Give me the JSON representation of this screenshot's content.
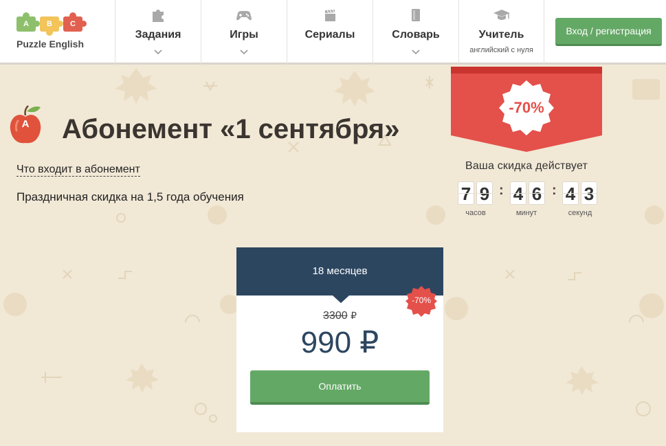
{
  "brand": {
    "name": "Puzzle English",
    "pieces": [
      "A",
      "B",
      "C"
    ],
    "colors": [
      "#8ec06c",
      "#f2c45a",
      "#e2604f"
    ]
  },
  "nav": {
    "items": [
      {
        "label": "Задания",
        "icon": "puzzle-icon",
        "dropdown": true
      },
      {
        "label": "Игры",
        "icon": "gamepad-icon",
        "dropdown": true
      },
      {
        "label": "Сериалы",
        "icon": "clapperboard-icon",
        "dropdown": false
      },
      {
        "label": "Словарь",
        "icon": "book-icon",
        "dropdown": true
      },
      {
        "label": "Учитель",
        "sub": "английский с нуля",
        "icon": "graduation-cap-icon",
        "dropdown": false
      }
    ],
    "login_label": "Вход / регистрация"
  },
  "hero": {
    "badge_letter": "A",
    "title": "Абонемент «1 сентября»",
    "includes_link": "Что входит в абонемент",
    "subtitle": "Праздничная скидка на 1,5 года обучения"
  },
  "promo": {
    "discount": "-70%",
    "caption": "Ваша скидка действует",
    "timer": {
      "hours": [
        "7",
        "9"
      ],
      "minutes": [
        "4",
        "6"
      ],
      "seconds": [
        "4",
        "3"
      ],
      "separator": ":",
      "hours_label": "часов",
      "minutes_label": "минут",
      "seconds_label": "секунд"
    }
  },
  "plan": {
    "title": "18 месяцев",
    "sticker": "-70%",
    "old_price": "3300",
    "currency_small": "₽",
    "new_price": "990 ₽",
    "pay_label": "Оплатить"
  },
  "colors": {
    "accent_green": "#64a866",
    "navy": "#2d4660",
    "promo_red": "#e4504a",
    "background": "#f1e8d6"
  }
}
